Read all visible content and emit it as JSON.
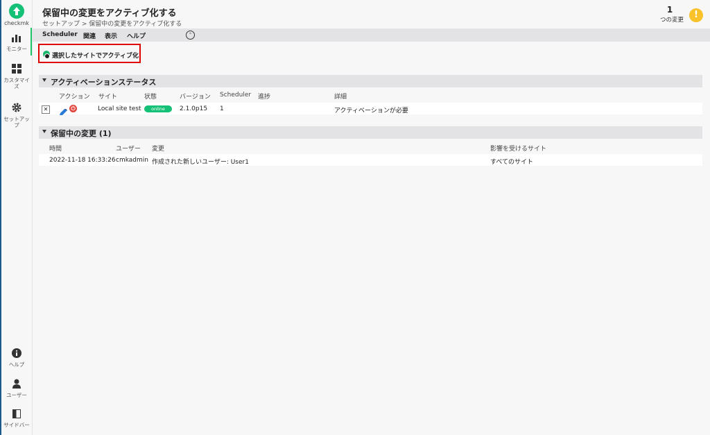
{
  "sidebar": {
    "logo_text": "checkmk",
    "items": [
      {
        "label": "モニター",
        "icon": "bar-chart-icon"
      },
      {
        "label": "カスタマイズ",
        "icon": "grid-icon"
      },
      {
        "label": "セットアップ",
        "icon": "gear-icon"
      },
      {
        "label": "ヘルプ",
        "icon": "info-icon"
      },
      {
        "label": "ユーザー",
        "icon": "user-icon"
      },
      {
        "label": "サイドバー",
        "icon": "sidebar-icon"
      }
    ]
  },
  "header": {
    "title": "保留中の変更をアクティブ化する",
    "breadcrumb": "セットアップ > 保留中の変更をアクティブ化する",
    "changes_count": "1",
    "changes_label": "つの変更",
    "warn_symbol": "!"
  },
  "menubar": {
    "items": [
      "Scheduler",
      "関連",
      "表示",
      "ヘルプ"
    ],
    "toggle_symbol": "⌃"
  },
  "action": {
    "activate_selected_label": "選択したサイトでアクティブ化",
    "highlight_color": "#e00000"
  },
  "activation_status": {
    "title": "アクティベーションステータス",
    "columns": [
      "アクション",
      "サイト",
      "状態",
      "バージョン",
      "Scheduler",
      "進捗",
      "詳細"
    ],
    "rows": [
      {
        "site": "Local site test",
        "status": "online",
        "version": "2.1.0p15",
        "scheduler": "1",
        "progress": "",
        "details": "アクティベーションが必要"
      }
    ]
  },
  "pending_changes": {
    "title": "保留中の変更 (1)",
    "columns": [
      "時間",
      "ユーザー",
      "変更",
      "影響を受けるサイト"
    ],
    "rows": [
      {
        "time": "2022-11-18 16:33:26",
        "user": "cmkadmin",
        "change": "作成された新しいユーザー: User1",
        "affected_sites": "すべてのサイト"
      }
    ]
  },
  "colors": {
    "accent": "#15c176",
    "warning": "#f9c12a",
    "danger": "#e2453c"
  }
}
